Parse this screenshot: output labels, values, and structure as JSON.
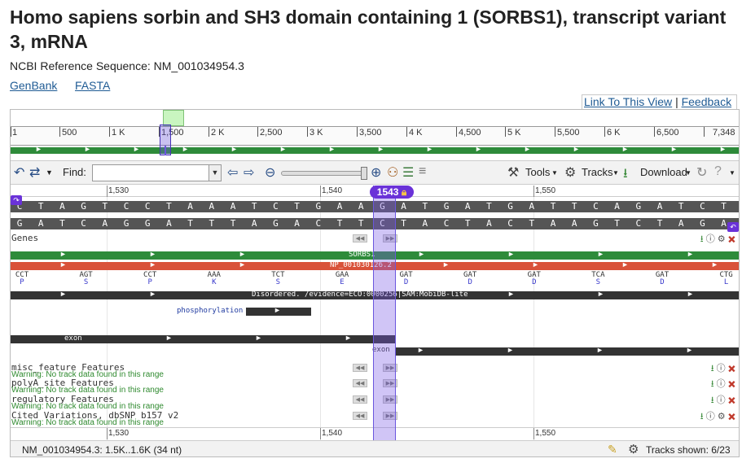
{
  "page": {
    "title": "Homo sapiens sorbin and SH3 domain containing 1 (SORBS1), transcript variant 3, mRNA",
    "refseq_label": "NCBI Reference Sequence: NM_001034954.3",
    "links": [
      "GenBank",
      "FASTA"
    ],
    "link_to_view": "Link To This View",
    "feedback": "Feedback",
    "separator": "|"
  },
  "panorama": {
    "ticks": [
      "1",
      "500",
      "1 K",
      "1,500",
      "2 K",
      "2,500",
      "3 K",
      "3,500",
      "4 K",
      "4,500",
      "5 K",
      "5,500",
      "6 K",
      "6,500",
      "7,348"
    ]
  },
  "toolbar": {
    "find_label": "Find:",
    "find_value": "",
    "tools": "Tools",
    "tracks": "Tracks",
    "download": "Download"
  },
  "ruler": {
    "labels": [
      "1,530",
      "1,540",
      "1,550"
    ],
    "position": "1543"
  },
  "sequence": {
    "forward": [
      "C",
      "T",
      "A",
      "G",
      "T",
      "C",
      "C",
      "T",
      "A",
      "A",
      "A",
      "T",
      "C",
      "T",
      "G",
      "A",
      "A",
      "G",
      "A",
      "T",
      "G",
      "A",
      "T",
      "G",
      "A",
      "T",
      "T",
      "C",
      "A",
      "G",
      "A",
      "T",
      "C",
      "T"
    ],
    "reverse": [
      "G",
      "A",
      "T",
      "C",
      "A",
      "G",
      "G",
      "A",
      "T",
      "T",
      "T",
      "A",
      "G",
      "A",
      "C",
      "T",
      "T",
      "C",
      "T",
      "A",
      "C",
      "T",
      "A",
      "C",
      "T",
      "A",
      "A",
      "G",
      "T",
      "C",
      "T",
      "A",
      "G",
      "A"
    ]
  },
  "tracks": {
    "genes_label": "Genes",
    "gene_name": "SORBS1",
    "protein_name": "NP_001030126.2",
    "codons": [
      {
        "codon": "CCT",
        "aa": "P"
      },
      {
        "codon": "AGT",
        "aa": "S"
      },
      {
        "codon": "CCT",
        "aa": "P"
      },
      {
        "codon": "AAA",
        "aa": "K"
      },
      {
        "codon": "TCT",
        "aa": "S"
      },
      {
        "codon": "GAA",
        "aa": "E"
      },
      {
        "codon": "GAT",
        "aa": "D"
      },
      {
        "codon": "GAT",
        "aa": "D"
      },
      {
        "codon": "GAT",
        "aa": "D"
      },
      {
        "codon": "TCA",
        "aa": "S"
      },
      {
        "codon": "GAT",
        "aa": "D"
      },
      {
        "codon": "CTG",
        "aa": "L"
      }
    ],
    "disordered": "Disordered. /evidence=ECO:0000256|SAM:MobiDB-lite",
    "phosphorylation": "phosphorylation",
    "exon1": "exon",
    "exon2": "exon",
    "misc_label": "misc_feature Features",
    "polya_label": "polyA_site Features",
    "regulatory_label": "regulatory Features",
    "cited_label": "Cited Variations, dbSNP b157 v2",
    "warning": "Warning: No track data found in this range"
  },
  "status": {
    "range": "NM_001034954.3: 1.5K..1.6K (34 nt)",
    "tracks_shown": "Tracks shown: 6/23"
  },
  "colors": {
    "gene": "#2e8b3a",
    "protein": "#d9523a",
    "highlight": "#6a32d8"
  }
}
